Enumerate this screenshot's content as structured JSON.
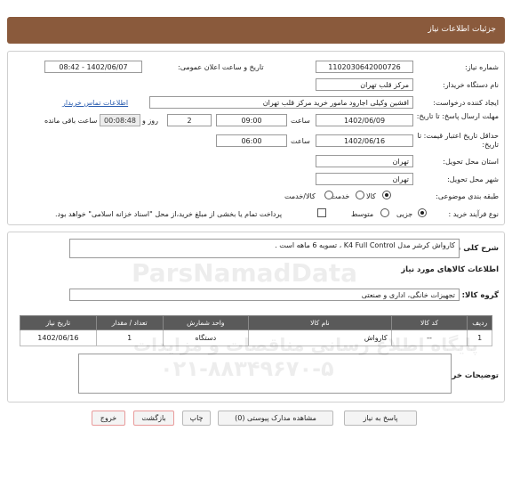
{
  "header": {
    "title": "جزئیات اطلاعات نیاز"
  },
  "form": {
    "need_number_label": "شماره نیاز:",
    "need_number": "1102030642000726",
    "announce_label": "تاریخ و ساعت اعلان عمومی:",
    "announce_value": "1402/06/07 - 08:42",
    "buyer_org_label": "نام دستگاه خریدار:",
    "buyer_org": "مرکز قلب تهران",
    "creator_label": "ایجاد کننده درخواست:",
    "creator": "افشین وکیلی اجارود مامور خرید مرکز قلب تهران",
    "contact_link": "اطلاعات تماس خریدار",
    "deadline_label": "مهلت ارسال پاسخ: تا تاریخ:",
    "deadline_date": "1402/06/09",
    "time_label": "ساعت",
    "deadline_time": "09:00",
    "days_value": "2",
    "days_label": "روز و",
    "remaining_time": "00:08:48",
    "remaining_label": "ساعت باقی مانده",
    "validity_label": "حداقل تاریخ اعتبار قیمت: تا تاریخ:",
    "validity_date": "1402/06/16",
    "validity_time": "06:00",
    "province_label": "استان محل تحویل:",
    "province": "تهران",
    "city_label": "شهر محل تحویل:",
    "city": "تهران",
    "category_label": "طبقه بندی موضوعی:",
    "category_options": [
      "کالا",
      "خدمت",
      "کالا/خدمت"
    ],
    "purchase_type_label": "نوع فرآیند خرید :",
    "purchase_options": [
      "جزیی",
      "متوسط"
    ],
    "payment_note": "پرداخت تمام یا بخشی از مبلغ خرید،از محل \"اسناد خزانه اسلامی\" خواهد بود."
  },
  "details": {
    "summary_label": "شرح کلی نیاز:",
    "summary": "کارواش کرشر مدل K4 Full Control ، تسویه 6 ماهه است .",
    "goods_info_title": "اطلاعات کالاهای مورد نیاز",
    "group_label": "گروه کالا:",
    "group_value": "تجهیزات خانگی، اداری و صنعتی",
    "table_headers": [
      "ردیف",
      "کد کالا",
      "نام کالا",
      "واحد شمارش",
      "تعداد / مقدار",
      "تاریخ نیاز"
    ],
    "table_rows": [
      [
        "1",
        "--",
        "کارواش",
        "دستگاه",
        "1",
        "1402/06/16"
      ]
    ],
    "buyer_notes_label": "توضیحات خریدار:"
  },
  "buttons": {
    "reply": "پاسخ به نیاز",
    "attachments": "مشاهده مدارک پیوستی (0)",
    "print": "چاپ",
    "back": "بازگشت",
    "exit": "خروج"
  },
  "watermark": {
    "brand": "ParsNamadData",
    "phone": "۰۲۱-۸۸۳۴۹۶۷۰-۵",
    "site_text": "پایگاه اطلاع رسانی مناقصات و مزایدات"
  }
}
